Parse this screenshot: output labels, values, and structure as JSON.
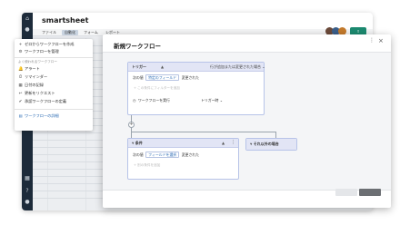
{
  "app": {
    "brand": "smartsheet",
    "menu": [
      "ファイル",
      "自動化",
      "フォーム",
      "レポート"
    ],
    "active_menu_index": 1,
    "avatars": [
      "#6b4a3a",
      "#3b5f8a",
      "#c47a2c"
    ],
    "share_color": "#1c8a70"
  },
  "dropdown": {
    "primary_items": [
      {
        "icon": "plus-icon",
        "glyph": "+",
        "label": "ゼロからワークフローを作成"
      },
      {
        "icon": "gear-icon",
        "glyph": "⚙",
        "label": "ワークフローを管理"
      }
    ],
    "section_heading": "よく使われるワークフロー",
    "template_items": [
      {
        "icon": "bell-icon",
        "glyph": "🔔",
        "label": "アラート"
      },
      {
        "icon": "clock-icon",
        "glyph": "⏱",
        "label": "リマインダー"
      },
      {
        "icon": "calendar-icon",
        "glyph": "▦",
        "label": "日付の記録"
      },
      {
        "icon": "request-icon",
        "glyph": "↩",
        "label": "更新をリクエスト"
      },
      {
        "icon": "approval-icon",
        "glyph": "✔",
        "label": "承認ワークフローの定義"
      }
    ],
    "footer_link": {
      "icon": "grid-icon",
      "glyph": "▤",
      "label": "ワークフローの詳細"
    }
  },
  "dialog": {
    "title": "新規ワークフロー",
    "trigger": {
      "label": "トリガー",
      "summary": "行が追加または変更された場合 ⌄",
      "when_label": "次の値",
      "field_select": "特定のフィールド",
      "changed_to": "変更された",
      "hint": "+ この条件にフィルターを追加",
      "run_label": "ワークフローを実行",
      "run_option": "トリガー時 ⌄"
    },
    "condition": {
      "label": "条件",
      "when_label": "次の値",
      "field_select": "フィールドを選択",
      "changed_to": "変更された",
      "hint": "+ 別の条件を追加"
    },
    "else_branch": {
      "label": "それ以外の場合"
    }
  }
}
